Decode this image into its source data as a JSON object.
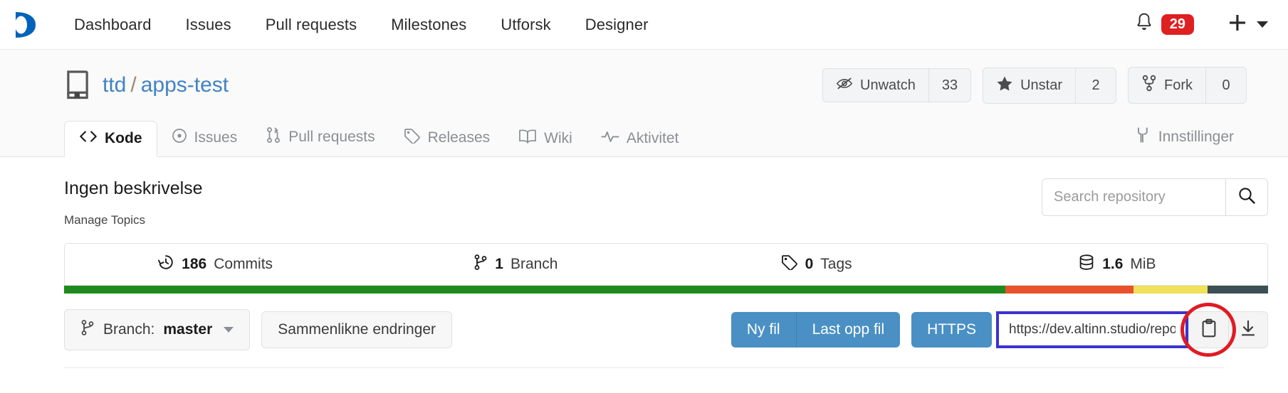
{
  "navbar": {
    "logo_name": "altinn-studio-logo",
    "links": [
      {
        "label": "Dashboard"
      },
      {
        "label": "Issues"
      },
      {
        "label": "Pull requests"
      },
      {
        "label": "Milestones"
      },
      {
        "label": "Utforsk"
      },
      {
        "label": "Designer"
      }
    ],
    "notifications": {
      "icon": "bell-icon",
      "count": "29",
      "badge_color": "#e02020"
    },
    "create_new": {
      "icon": "plus-icon",
      "caret": "chevron-down-icon"
    }
  },
  "repo": {
    "icon": "repository-icon",
    "owner": "ttd",
    "separator": "/",
    "name": "apps-test",
    "link_color": "#4183c4",
    "actions": [
      {
        "icon": "eye-slash-icon",
        "label": "Unwatch",
        "count": "33"
      },
      {
        "icon": "star-filled-icon",
        "label": "Unstar",
        "count": "2"
      },
      {
        "icon": "fork-icon",
        "label": "Fork",
        "count": "0"
      }
    ]
  },
  "tabs": {
    "items": [
      {
        "icon": "code-icon",
        "label": "Kode",
        "active": true
      },
      {
        "icon": "issue-opened-icon",
        "label": "Issues",
        "active": false
      },
      {
        "icon": "pull-request-icon",
        "label": "Pull requests",
        "active": false
      },
      {
        "icon": "tag-icon",
        "label": "Releases",
        "active": false
      },
      {
        "icon": "book-icon",
        "label": "Wiki",
        "active": false
      },
      {
        "icon": "pulse-icon",
        "label": "Aktivitet",
        "active": false
      }
    ],
    "settings": {
      "icon": "wrench-icon",
      "label": "Innstillinger"
    }
  },
  "main": {
    "description": "Ingen beskrivelse",
    "manage_topics": "Manage Topics",
    "search": {
      "placeholder": "Search repository",
      "value": "",
      "icon": "search-icon"
    },
    "stats": [
      {
        "icon": "history-icon",
        "value": "186",
        "label": "Commits"
      },
      {
        "icon": "branch-icon",
        "value": "1",
        "label": "Branch"
      },
      {
        "icon": "tag-icon",
        "value": "0",
        "label": "Tags"
      },
      {
        "icon": "database-icon",
        "value": "1.6",
        "label": "MiB"
      }
    ],
    "languages": [
      {
        "color": "#1e8a1e",
        "percent": 78.2
      },
      {
        "color": "#e8512c",
        "percent": 10.6
      },
      {
        "color": "#f1e05a",
        "percent": 6.2
      },
      {
        "color": "#3b4f54",
        "percent": 5.0
      }
    ],
    "branch_button": {
      "icon": "branch-icon",
      "prefix": "Branch:",
      "name": "master",
      "caret": "chevron-down-icon"
    },
    "compare_button": "Sammenlikne endringer",
    "new_file_button": "Ny fil",
    "upload_file_button": "Last opp fil",
    "protocol_button": "HTTPS",
    "clone_url": "https://dev.altinn.studio/repos/ttd/app",
    "copy_button": {
      "icon": "clipboard-icon",
      "highlight_color": "#e01b24"
    },
    "download_button": {
      "icon": "download-icon"
    },
    "blue_button_color": "#4a90c4",
    "url_focus_border_color": "#3b32cf"
  }
}
